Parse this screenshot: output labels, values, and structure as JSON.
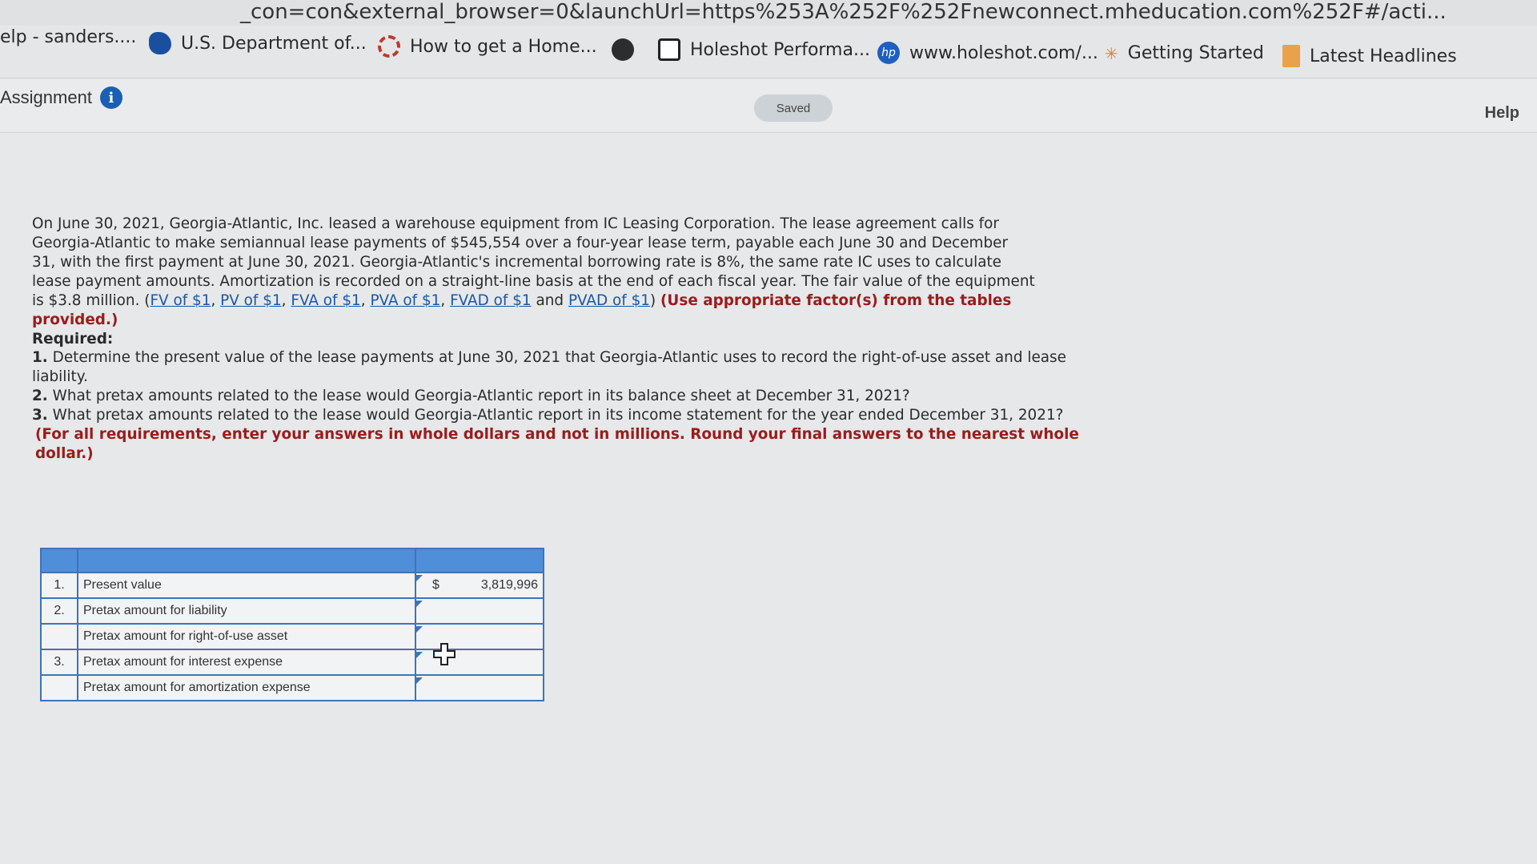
{
  "browser": {
    "url_text": "_con=con&external_browser=0&launchUrl=https%253A%252F%252Fnewconnect.mheducation.com%252F#/acti...",
    "bookmarks": [
      {
        "label": "elp - sanders....",
        "icon": "none"
      },
      {
        "label": "U.S. Department of...",
        "icon": "state-icon"
      },
      {
        "label": "How to get a Home...",
        "icon": "loading-ring-icon"
      },
      {
        "label": "",
        "icon": "globe-icon"
      },
      {
        "label": "Holeshot Performa...",
        "icon": "holeshot-icon"
      },
      {
        "label": "www.holeshot.com/...",
        "icon": "hp-icon"
      },
      {
        "label": "Getting Started",
        "icon": "firefox-star-icon"
      },
      {
        "label": "Latest Headlines",
        "icon": "bookmark-folder-icon"
      }
    ]
  },
  "header": {
    "title": "Assignment",
    "saved_label": "Saved",
    "help_label": "Help"
  },
  "question": {
    "para_lines": [
      "On June 30, 2021, Georgia-Atlantic, Inc. leased a warehouse equipment  from IC Leasing Corporation. The lease agreement calls for",
      "Georgia-Atlantic to make semiannual lease payments of $545,554 over a four-year lease term, payable each June 30 and December",
      "31, with the first payment at June 30, 2021. Georgia-Atlantic's incremental borrowing rate is 8%, the same rate IC uses to calculate",
      "lease payment amounts. Amortization is recorded on a straight-line basis at the end of each fiscal year. The fair value of the equipment"
    ],
    "last_line_prefix": "is $3.8 million. (",
    "links": [
      "FV of $1",
      "PV of $1",
      "FVA of $1",
      "PVA of $1",
      "FVAD of $1",
      "PVAD of $1"
    ],
    "and_word": "and",
    "instruction": "(Use appropriate factor(s) from the tables provided.)",
    "required_heading": "Required:",
    "requirements": [
      {
        "num": "1.",
        "text": "Determine the present value of the lease payments at June 30, 2021 that Georgia-Atlantic uses to record the right-of-use asset and lease liability."
      },
      {
        "num": "2.",
        "text": "What pretax amounts related to the lease would Georgia-Atlantic report in its balance sheet at December 31, 2021?"
      },
      {
        "num": "3.",
        "text": "What pretax amounts related to the lease would Georgia-Atlantic report in its income statement for the year ended December 31, 2021?"
      }
    ],
    "note": "(For all requirements, enter your answers in whole dollars and not in millions. Round your final answers to the nearest whole dollar.)"
  },
  "table": {
    "rows": [
      {
        "num": "1.",
        "label": "Present value",
        "currency": "$",
        "value": "3,819,996"
      },
      {
        "num": "2.",
        "label": "Pretax amount for liability",
        "currency": "",
        "value": ""
      },
      {
        "num": "",
        "label": "Pretax amount for right-of-use asset",
        "currency": "",
        "value": ""
      },
      {
        "num": "3.",
        "label": "Pretax amount for interest expense",
        "currency": "",
        "value": ""
      },
      {
        "num": "",
        "label": "Pretax amount for amortization expense",
        "currency": "",
        "value": ""
      }
    ]
  }
}
